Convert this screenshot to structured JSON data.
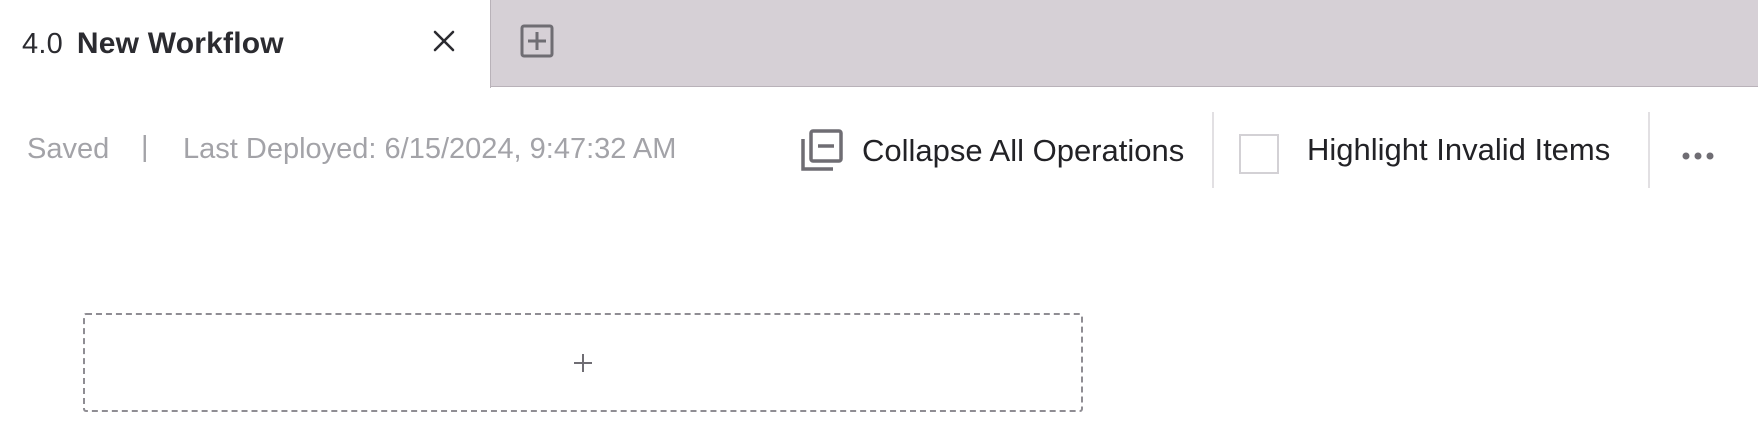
{
  "tab": {
    "version": "4.0",
    "title": "New Workflow",
    "close_icon": "close-icon",
    "add_icon": "add-tab-icon"
  },
  "toolbar": {
    "saved_status": "Saved",
    "separator": "|",
    "last_deployed": "Last Deployed: 6/15/2024, 9:47:32 AM",
    "collapse_label": "Collapse All Operations",
    "collapse_icon": "collapse-all-icon",
    "highlight_label": "Highlight Invalid Items",
    "highlight_checked": false,
    "more_icon": "more-options-icon"
  },
  "canvas": {
    "add_icon": "plus-icon"
  },
  "colors": {
    "tabbar_bg": "#d6d0d6",
    "muted_text": "#a3a3a8",
    "primary_text": "#222226",
    "icon": "#6f6d73"
  }
}
